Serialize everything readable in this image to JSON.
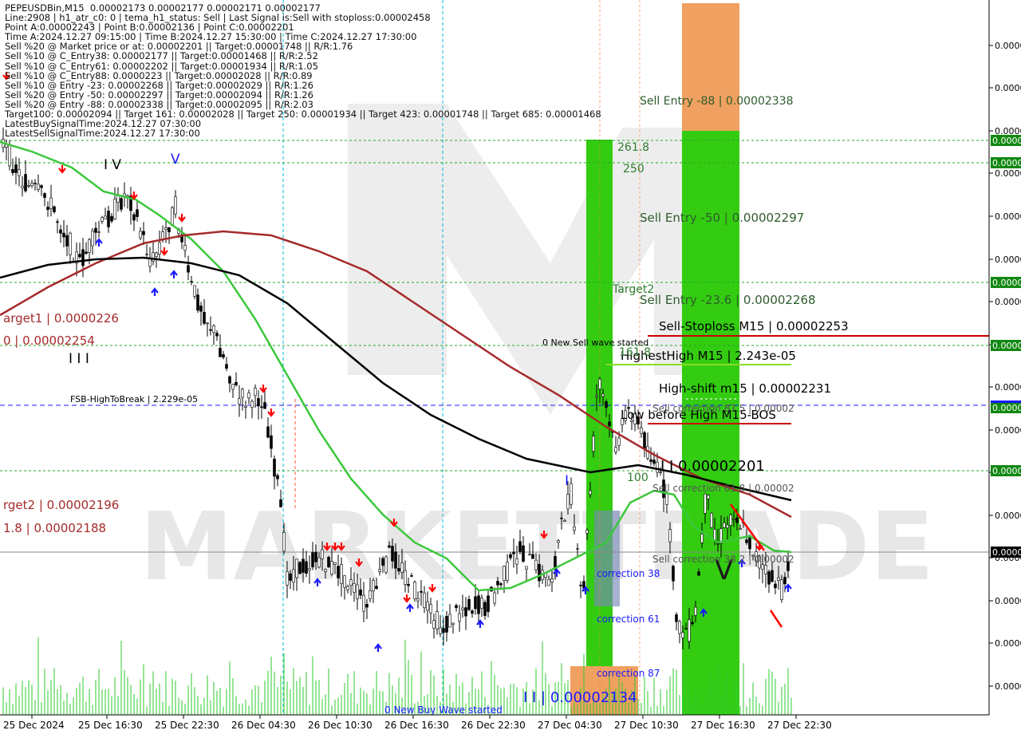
{
  "chart_data": {
    "type": "line",
    "title": "",
    "xlabel": "",
    "ylabel": "",
    "info_lines": [
      "PEPEUSDBin,M15  0.00002173 0.00002177 0.00002171 0.00002177",
      "Line:2908 | h1_atr_c0: 0 | tema_h1_status: Sell | Last Signal is:Sell with stoploss:0.00002458",
      "Point A:0.00002243 | Point B:0.00002136 | Point C:0.00002201",
      "Time A:2024.12.27 09:15:00 | Time B:2024.12.27 15:30:00 | Time C:2024.12.27 17:30:00",
      "Sell %20 @ Market price or at: 0.00002201 || Target:0.00001748 || R/R:1.76",
      "Sell %10 @ C_Entry38: 0.00002177 || Target:0.00001468 || R/R:2.52",
      "Sell %10 @ C_Entry61: 0.00002202 || Target:0.00001934 || R/R:1.05",
      "Sell %10 @ C_Entry88: 0.0000223 || Target:0.00002028 || R/R:0.89",
      "Sell %10 @ Entry -23: 0.00002268 || Target:0.00002029 || R/R:1.26",
      "Sell %20 @ Entry -50: 0.00002297 || Target:0.00002094 || R/R:1.26",
      "Sell %20 @ Entry -88: 0.00002338 || Target:0.00002095 || R/R:2.03",
      "Target100: 0.00002094 || Target 161: 0.00002028 || Target 250: 0.00001934 || Target 423: 0.00001748 || Target 685: 0.00001468",
      "LatestBuySignalTime:2024.12.27 07:30:00",
      "LatestSellSignalTime:2024.12.27 17:30:00"
    ],
    "x_tick_labels": [
      "25 Dec 2024",
      "25 Dec 16:30",
      "25 Dec 22:30",
      "26 Dec 04:30",
      "26 Dec 10:30",
      "26 Dec 16:30",
      "26 Dec 22:30",
      "27 Dec 04:30",
      "27 Dec 10:30",
      "27 Dec 16:30",
      "27 Dec 22:30"
    ],
    "y_tick_labels": [
      "0.0000",
      "0.0000",
      "0.0000",
      "0.0000",
      "0.0000",
      "0.0000",
      "0.0000",
      "0.0000",
      "0.0000",
      "0.0000",
      "0.0000",
      "0.0000",
      "0.0000",
      "0.0000",
      "0.0000",
      "0.0000"
    ],
    "level_tags": [
      "0.0000",
      "0.0000",
      "0.0000",
      "0.0000",
      "0.0000",
      "0.0000",
      "0.0000",
      "0.0000"
    ],
    "annotations": {
      "wave_labels": [
        "I V",
        "V",
        "I I I",
        "I",
        "I I | 0.00002134",
        "I I 0.00002201",
        "V"
      ],
      "left_levels": [
        "arget1 | 0.0000226",
        "0 | 0.00002254",
        "FSB-HighToBreak | 2.229e-05",
        "rget2 | 0.00002196",
        "1.8 | 0.00002188"
      ],
      "entries": [
        "Sell Entry -88 | 0.00002338",
        "Sell Entry -50 | 0.00002297",
        "Sell Entry -23.6 | 0.00002268"
      ],
      "stoploss": "Sell-Stoploss M15 | 0.00002253",
      "highest_high": "HighestHigh   M15 | 2.243e-05",
      "high_shift": "High-shift m15 | 0.00002231",
      "low_before_high": "Low before High   M15-BOS",
      "fib_labels": [
        "261.8",
        "250",
        "Target2",
        "161.8",
        "100"
      ],
      "corrections": [
        "correction 38",
        "correction 61",
        "correction 87"
      ],
      "sell_corrections": [
        "Sell correction 87.5 | 0.00002",
        "Sell correction 61.8 | 0.00002",
        "Sell correction 38.2 | 0.00002"
      ],
      "wave_started": [
        "0 New Sell wave started",
        "0 New Buy Wave started"
      ],
      "watermark": "MARKETTRADE"
    },
    "series": [
      {
        "values": [
          2.26e-05,
          2.255e-05,
          2.252e-05,
          2.25e-05,
          2.252e-05,
          2.238e-05,
          2.232e-05,
          2.224e-05,
          2.215e-05,
          2.207e-05,
          2.198e-05,
          2.188e-05,
          2.182e-05,
          2.175e-05,
          2.171e-05,
          2.167e-05,
          2.164e-05,
          2.162e-05,
          2.162e-05,
          2.165e-05,
          2.168e-05,
          2.172e-05,
          2.174e-05,
          2.176e-05,
          2.178e-05,
          2.182e-05,
          2.19e-05,
          2.2e-05,
          2.205e-05,
          2.203e-05,
          2.197e-05,
          2.188e-05,
          2.18e-05,
          2.178e-05
        ]
      },
      {
        "values": [
          2.222e-05,
          2.228e-05,
          2.234e-05,
          2.24e-05,
          2.244e-05,
          2.247e-05,
          2.248e-05,
          2.248e-05,
          2.246e-05,
          2.243e-05,
          2.24e-05,
          2.236e-05,
          2.232e-05,
          2.228e-05,
          2.223e-05,
          2.216e-05,
          2.21e-05,
          2.205e-05,
          2.199e-05,
          2.194e-05,
          2.191e-05
        ]
      },
      {
        "values": [
          2.23e-05,
          2.233e-05,
          2.233e-05,
          2.232e-05,
          2.231e-05,
          2.228e-05,
          2.221e-05,
          2.214e-05,
          2.207e-05,
          2.201e-05,
          2.197e-05,
          2.191e-05,
          2.185e-05,
          2.184e-05,
          2.186e-05,
          2.189e-05,
          2.189e-05,
          2.19e-05,
          2.184e-05
        ]
      }
    ],
    "colors": {
      "fast_ma": "#3cc83c",
      "mid_ma": "#a52a2a",
      "slow_ma": "#000000",
      "sell_arrow": "#ff0000",
      "buy_arrow": "#0000ff",
      "stoploss": "#cc0000",
      "band_green": "#33cc11",
      "band_orange": "#f0a060"
    },
    "grid": "horizontal dotted"
  }
}
